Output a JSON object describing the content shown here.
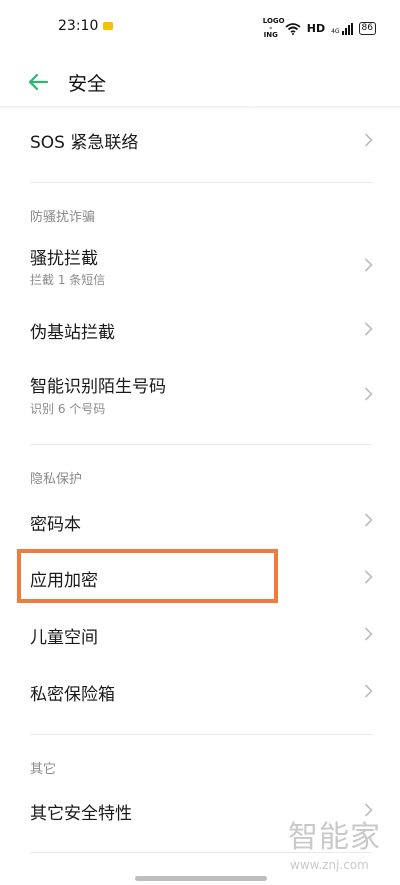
{
  "status_bar": {
    "time": "23:10",
    "hd": "HD",
    "battery": "86",
    "net_label": "4G",
    "logo_text_top": "LOGO",
    "logo_text_bottom": "-ING"
  },
  "header": {
    "title": "安全"
  },
  "items": {
    "sos": {
      "label": "SOS 紧急联络"
    },
    "section_anti_harass": "防骚扰诈骗",
    "harass_block": {
      "label": "骚扰拦截",
      "sub": "拦截 1 条短信"
    },
    "fake_station": {
      "label": "伪基站拦截"
    },
    "stranger_id": {
      "label": "智能识别陌生号码",
      "sub": "识别 6 个号码"
    },
    "section_privacy": "隐私保护",
    "password_book": {
      "label": "密码本"
    },
    "app_encrypt": {
      "label": "应用加密"
    },
    "kids_space": {
      "label": "儿童空间"
    },
    "private_safe": {
      "label": "私密保险箱"
    },
    "section_other": "其它",
    "other_security": {
      "label": "其它安全特性"
    }
  },
  "watermark": {
    "main": "智能家",
    "url": "www.znj.com"
  },
  "colors": {
    "accent": "#2bb673",
    "highlight": "#f07b3f",
    "secondary_text": "#8a8a8a"
  }
}
